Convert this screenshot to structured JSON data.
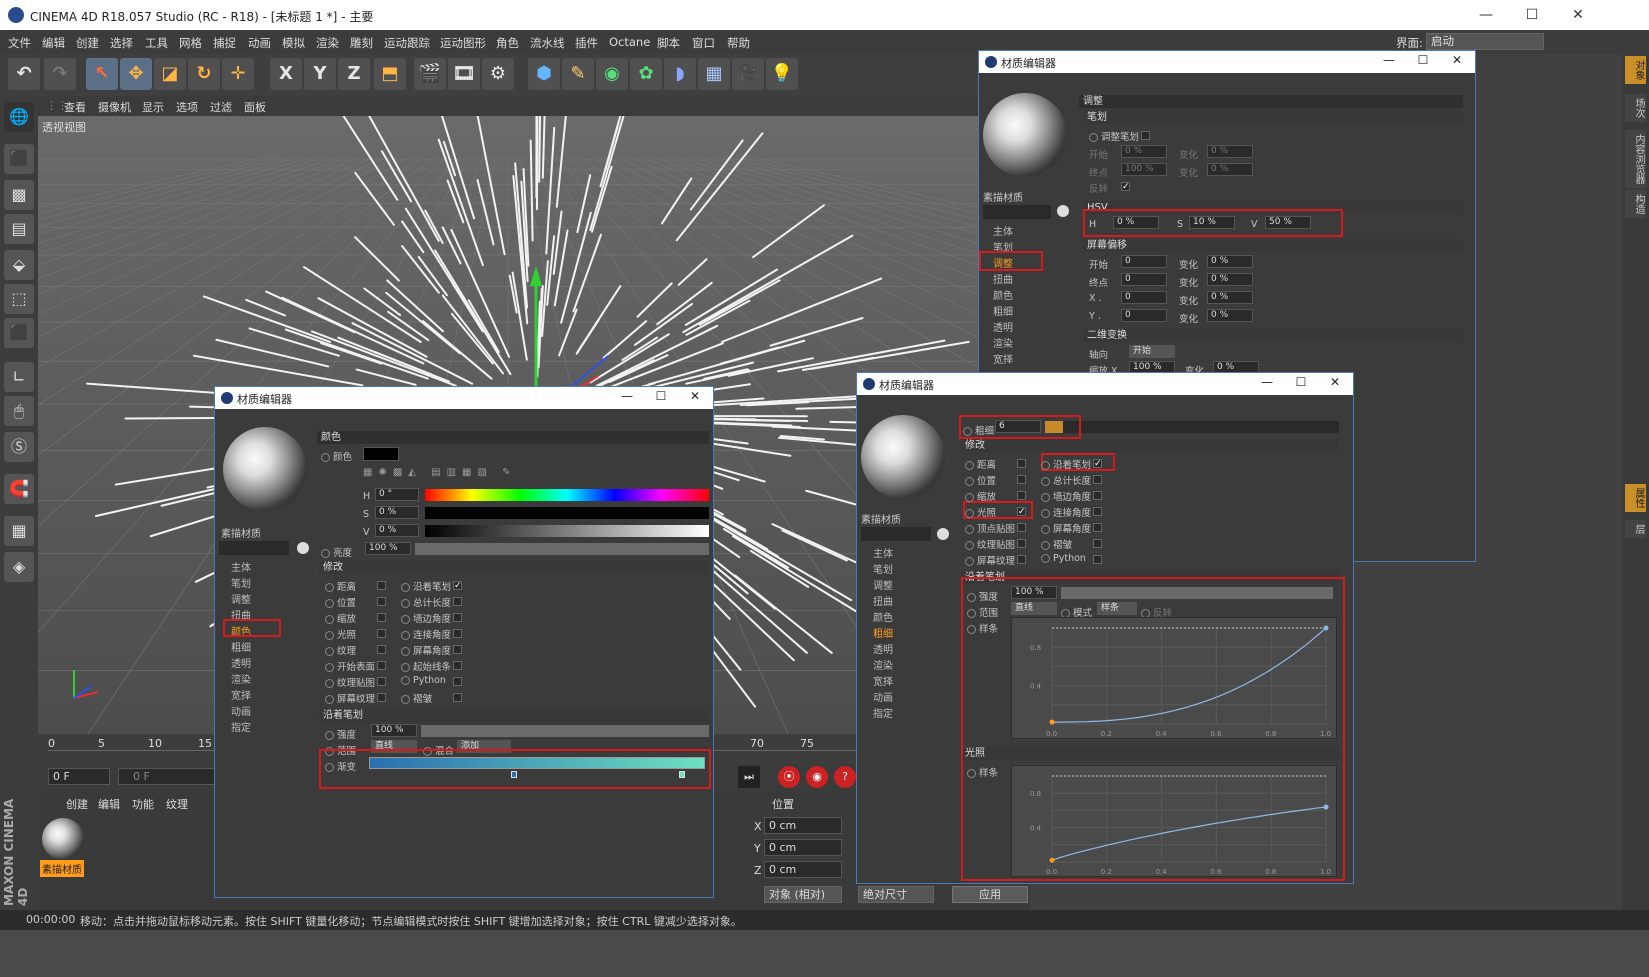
{
  "app": {
    "title": "CINEMA 4D R18.057 Studio (RC - R18) - [未标题 1 *] - 主要",
    "brand": "MAXON CINEMA 4D"
  },
  "menu": [
    "文件",
    "编辑",
    "创建",
    "选择",
    "工具",
    "网格",
    "捕捉",
    "动画",
    "模拟",
    "渲染",
    "雕刻",
    "运动跟踪",
    "运动图形",
    "角色",
    "流水线",
    "插件",
    "Octane",
    "脚本",
    "窗口",
    "帮助"
  ],
  "layout": {
    "label": "界面:",
    "value": "启动"
  },
  "toolbar": {
    "x": "X",
    "y": "Y",
    "z": "Z"
  },
  "viewport": {
    "menu": [
      "查看",
      "摄像机",
      "显示",
      "选项",
      "过滤",
      "面板"
    ],
    "label": "透视视图"
  },
  "timeline": {
    "ticks": [
      "0",
      "5",
      "10",
      "15",
      "70",
      "75"
    ],
    "frame_start": "0 F",
    "frame_cur": "0 F"
  },
  "material_manager": {
    "menu": [
      "创建",
      "编辑",
      "功能",
      "纹理"
    ],
    "material_name": "素描材质"
  },
  "coords": {
    "title": "位置",
    "rows": [
      {
        "axis": "X",
        "value": "0 cm"
      },
      {
        "axis": "Y",
        "value": "0 cm"
      },
      {
        "axis": "Z",
        "value": "0 cm"
      }
    ],
    "mode": "对象 (相对)",
    "size_mode": "绝对尺寸",
    "apply": "应用"
  },
  "status": {
    "time": "00:00:00",
    "message": "移动：点击并拖动鼠标移动元素。按住 SHIFT 键量化移动；节点编辑模式时按住 SHIFT 键增加选择对象；按住 CTRL 键减少选择对象。"
  },
  "right_tabs": [
    "对象",
    "场次",
    "内容浏览器",
    "构造",
    "属性",
    "层"
  ],
  "editor_common": {
    "title": "材质编辑器",
    "material_name": "素描材质",
    "channels": [
      "主体",
      "笔划",
      "调整",
      "扭曲",
      "颜色",
      "粗细",
      "透明",
      "渲染",
      "宽择",
      "动画",
      "指定"
    ]
  },
  "editor_top": {
    "selected": "调整",
    "section_title": "调整",
    "stroke_header": "笔划",
    "adjust_stroke": "调整笔划",
    "start": "开始",
    "start_val": "0 %",
    "change": "变化",
    "change_val": "0 %",
    "end": "终点",
    "end_val": "100 %",
    "change2_val": "0 %",
    "invert": "反转",
    "hsv_header": "HSV",
    "h_label": "H",
    "h_val": "0 %",
    "s_label": "S",
    "s_val": "10 %",
    "v_label": "V",
    "v_val": "50 %",
    "offset_header": "屏幕偏移",
    "off_rows": [
      {
        "l": "开始",
        "v": "0"
      },
      {
        "l": "终点",
        "v": "0"
      },
      {
        "l": "X .",
        "v": "0"
      },
      {
        "l": "Y .",
        "v": "0"
      }
    ],
    "off_change": "变化",
    "off_change_val": "0 %",
    "twod_header": "二维变换",
    "axis": "轴向",
    "axis_val": "开始",
    "scale_x": "缩放 X",
    "scale_x_val": "100 %",
    "scale_change": "变化",
    "scale_change_val": "0 %"
  },
  "editor_left": {
    "selected": "颜色",
    "section_title": "颜色",
    "color_label": "颜色",
    "h": "H",
    "h_val": "0 °",
    "s": "S",
    "s_val": "0 %",
    "v": "V",
    "v_val": "0 %",
    "brightness": "亮度",
    "brightness_val": "100 %",
    "modify_header": "修改",
    "mods_left": [
      "距离",
      "位置",
      "缩放",
      "光照",
      "纹理",
      "开始表面",
      "纹理贴图",
      "屏幕纹理"
    ],
    "mods_right": [
      "沿着笔划",
      "总计长度",
      "墙边角度",
      "连接角度",
      "屏幕角度",
      "起始线条",
      "Python",
      "褶皱"
    ],
    "along_header": "沿着笔划",
    "strength": "强度",
    "strength_val": "100 %",
    "range": "范围",
    "range_val": "直线",
    "mix": "混合",
    "mix_val": "添加",
    "gradient": "渐变"
  },
  "editor_right": {
    "selected": "粗细",
    "thickness": "粗细",
    "thickness_val": "6",
    "modify_header": "修改",
    "mods_left": [
      "距离",
      "位置",
      "缩放",
      "光照",
      "顶点贴图",
      "纹理贴图",
      "屏幕纹理"
    ],
    "mods_right": [
      "沿着笔划",
      "总计长度",
      "墙边角度",
      "连接角度",
      "屏幕角度",
      "褶皱",
      "Python"
    ],
    "along_header": "沿着笔划",
    "strength": "强度",
    "strength_val": "100 %",
    "range": "范围",
    "range_val": "直线",
    "mode": "模式",
    "mode_val": "样条",
    "invert": "反转",
    "spline": "样条",
    "light_header": "光照",
    "spline2": "样条",
    "y_ticks": [
      "0.8",
      "0.4"
    ],
    "x_ticks": [
      "0.0",
      "0.2",
      "0.4",
      "0.6",
      "0.8",
      "1.0"
    ]
  },
  "colors": {
    "accent_orange": "#ff9c1a",
    "highlight_red": "#d21c1c",
    "window_border": "#4a7bb8",
    "gradient_start": "#2b6fb0",
    "gradient_end": "#6fe0c0"
  }
}
